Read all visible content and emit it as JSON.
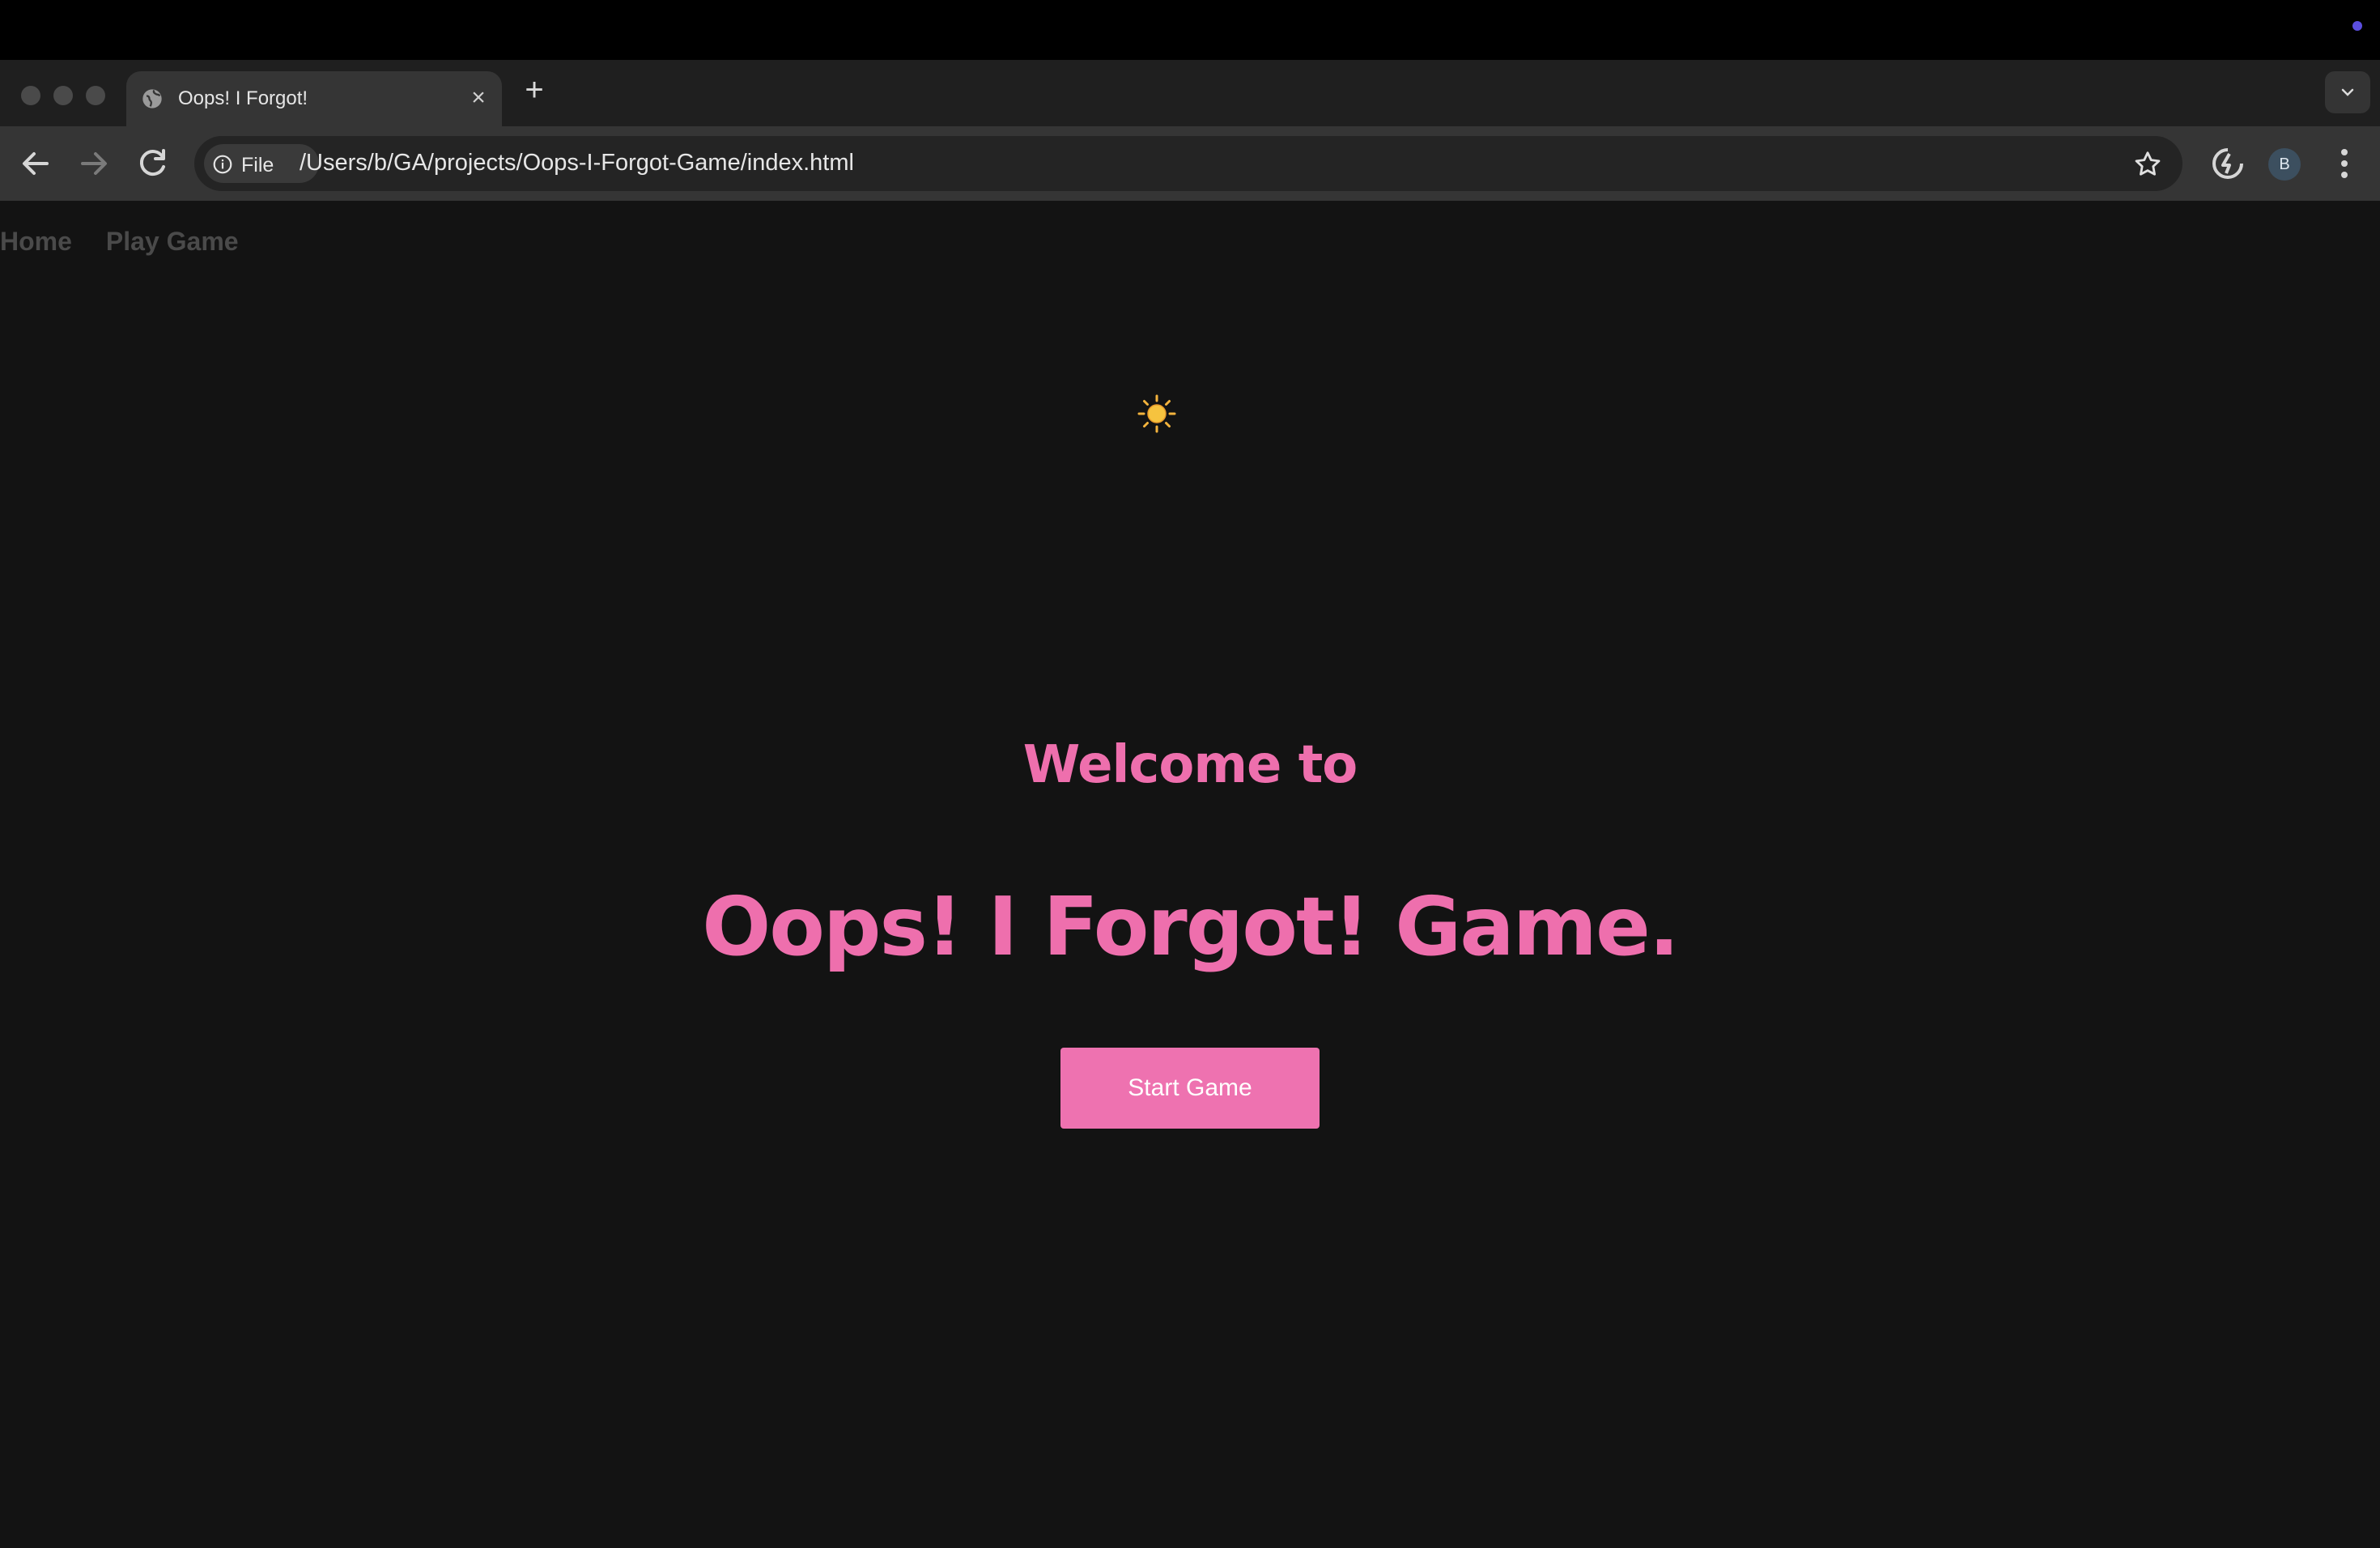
{
  "browser": {
    "tab": {
      "title": "Oops! I Forgot!",
      "icon": "globe-icon"
    },
    "new_tab_label": "+",
    "chip_label": "File",
    "url": "/Users/b/GA/projects/Oops-I-Forgot-Game/index.html",
    "profile_initial": "B",
    "colors": {
      "tabstrip": "#1f1f1f",
      "toolbar": "#353535",
      "omnibox": "#242424"
    }
  },
  "page": {
    "nav": {
      "home": "Home",
      "play": "Play Game"
    },
    "theme_toggle": "☀️",
    "welcome": "Welcome to",
    "title": "Oops! I Forgot! Game.",
    "start_button": "Start Game",
    "colors": {
      "background": "#131313",
      "accent": "#ee72b0",
      "nav_text": "#4a4a4a"
    }
  }
}
